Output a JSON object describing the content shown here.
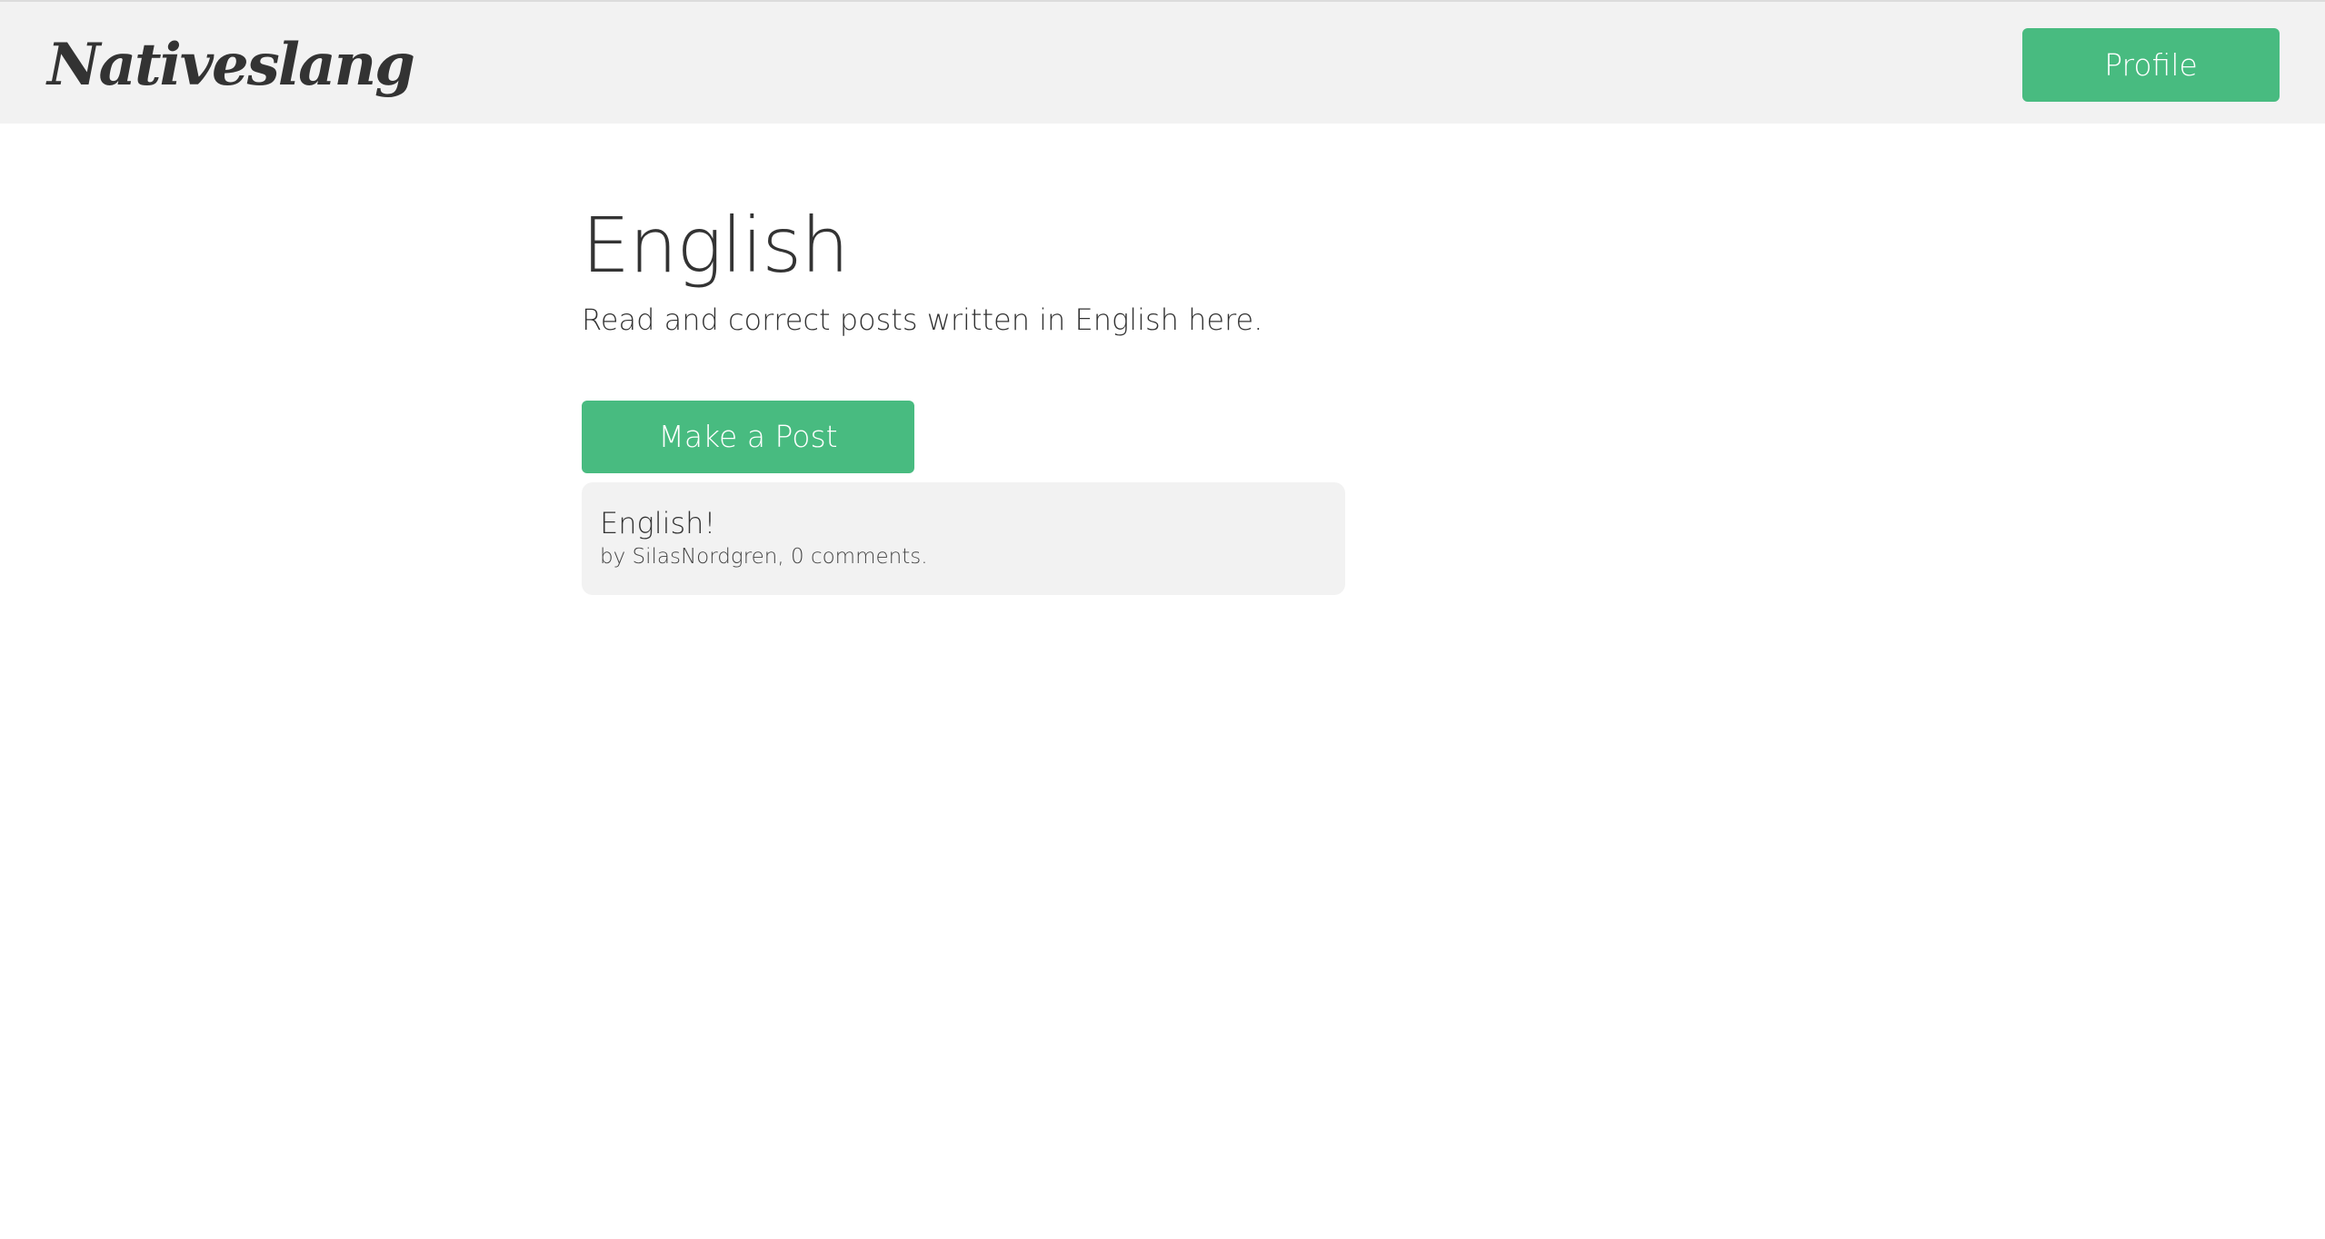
{
  "navbar": {
    "logo": "Nativeslang",
    "profile_label": "Profile"
  },
  "main": {
    "title": "English",
    "subtitle": "Read and correct posts written in English here.",
    "make_post_label": "Make a Post",
    "posts": [
      {
        "title": "English!",
        "meta": "by SilasNordgren, 0 comments."
      }
    ]
  },
  "colors": {
    "accent": "#48bb80",
    "navbar_bg": "#f2f2f2",
    "card_bg": "#f2f2f2",
    "text": "#333333"
  }
}
